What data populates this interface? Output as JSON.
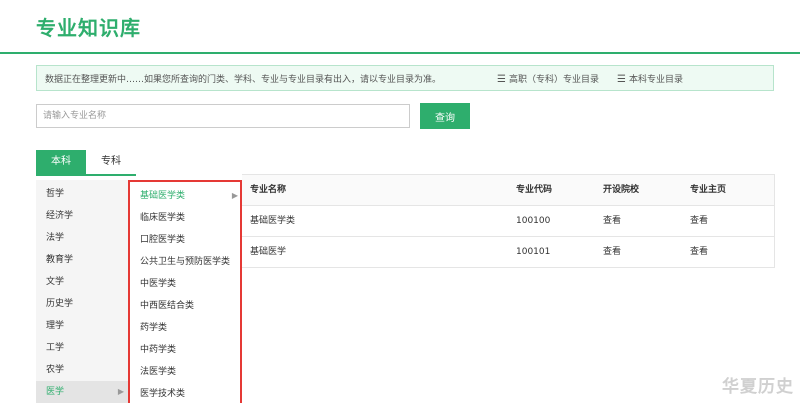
{
  "header": {
    "title": "专业知识库"
  },
  "notice": {
    "message": "数据正在整理更新中……如果您所查询的门类、学科、专业与专业目录有出入，请以专业目录为准。",
    "links": [
      {
        "icon": "list-icon",
        "label": "高职（专科）专业目录"
      },
      {
        "icon": "list-icon",
        "label": "本科专业目录"
      }
    ]
  },
  "search": {
    "placeholder": "请输入专业名称",
    "button_label": "查询"
  },
  "tabs": [
    {
      "label": "本科",
      "active": true
    },
    {
      "label": "专科",
      "active": false
    }
  ],
  "categories": [
    "哲学",
    "经济学",
    "法学",
    "教育学",
    "文学",
    "历史学",
    "理学",
    "工学",
    "农学",
    "医学"
  ],
  "selected_category": "医学",
  "subcategories": [
    "基础医学类",
    "临床医学类",
    "口腔医学类",
    "公共卫生与预防医学类",
    "中医学类",
    "中西医结合类",
    "药学类",
    "中药学类",
    "法医学类",
    "医学技术类"
  ],
  "selected_subcategory": "基础医学类",
  "table": {
    "headers": [
      "专业名称",
      "专业代码",
      "开设院校",
      "专业主页"
    ],
    "rows": [
      [
        "基础医学类",
        "100100",
        "查看",
        "查看"
      ],
      [
        "基础医学",
        "100101",
        "查看",
        "查看"
      ]
    ]
  },
  "watermark": "华夏历史",
  "colors": {
    "accent": "#2eae6d",
    "highlight_border": "#e53935"
  }
}
